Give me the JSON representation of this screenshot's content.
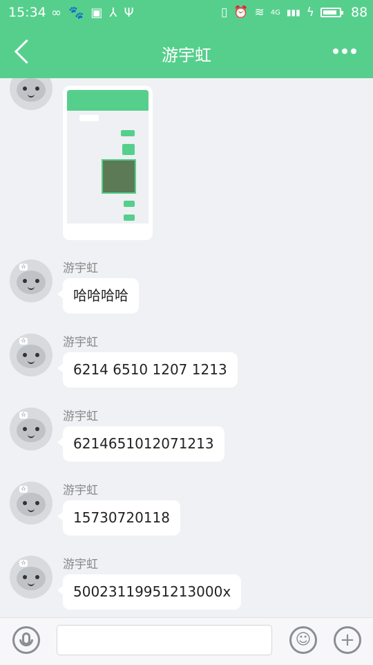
{
  "status_bar": {
    "time": "15:34",
    "battery": "88",
    "left_icons": [
      "∞",
      "🐾",
      "▣",
      "⅄",
      "Ψ"
    ],
    "right_icons": [
      "▯",
      "⏰",
      "≋",
      "4G",
      "▮▮▮",
      "ϟ"
    ]
  },
  "header": {
    "title": "游宇虹"
  },
  "messages": [
    {
      "type": "image",
      "sender": ""
    },
    {
      "type": "text",
      "sender": "游宇虹",
      "text": "哈哈哈哈"
    },
    {
      "type": "text",
      "sender": "游宇虹",
      "text": "6214 6510 1207 1213"
    },
    {
      "type": "text",
      "sender": "游宇虹",
      "text": "6214651012071213"
    },
    {
      "type": "text",
      "sender": "游宇虹",
      "text": "15730720118"
    },
    {
      "type": "text",
      "sender": "游宇虹",
      "text": "50023119951213000x"
    }
  ],
  "input_bar": {
    "placeholder": "",
    "plus": "+"
  },
  "colors": {
    "accent": "#56cf8d",
    "background": "#f0f1f4",
    "bubble": "#ffffff",
    "sender_text": "#888888"
  }
}
